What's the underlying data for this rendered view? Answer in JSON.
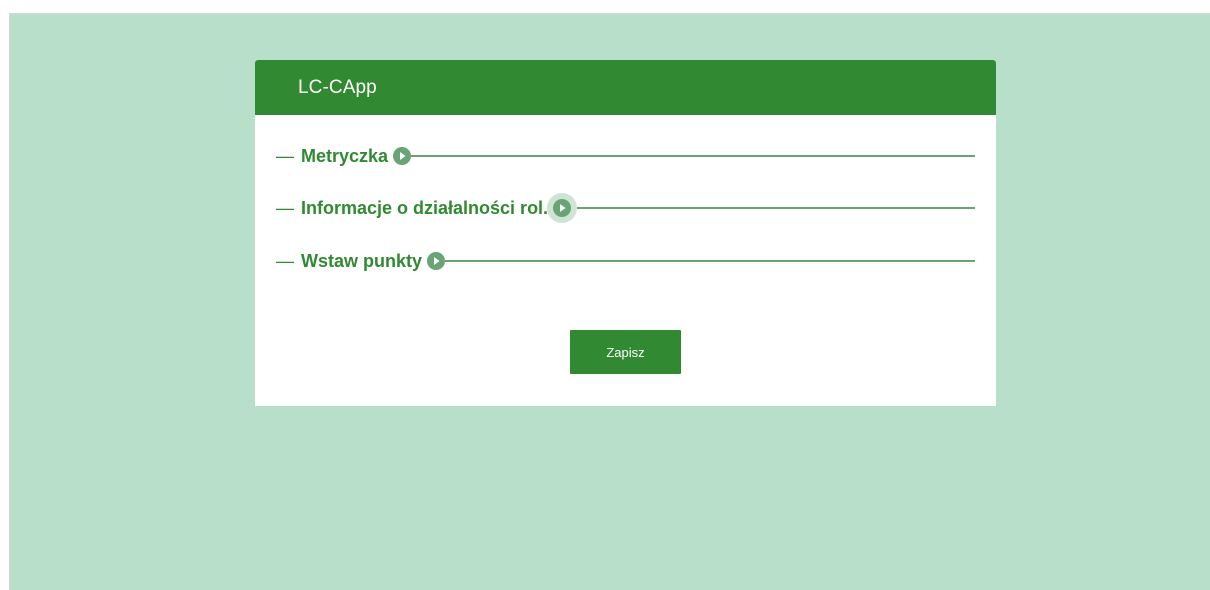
{
  "app": {
    "title": "LC-CApp"
  },
  "sections": [
    {
      "dash": "—",
      "label": "Metryczka",
      "icon": "play-circle-icon"
    },
    {
      "dash": "—",
      "label": "Informacje o działalności rol.",
      "icon": "play-circle-icon"
    },
    {
      "dash": "—",
      "label": "Wstaw punkty",
      "icon": "play-circle-icon"
    }
  ],
  "actions": {
    "save_label": "Zapisz"
  },
  "colors": {
    "background": "#b8dfca",
    "brand": "#318a32",
    "accent_light": "#6aa374",
    "card": "#ffffff"
  }
}
